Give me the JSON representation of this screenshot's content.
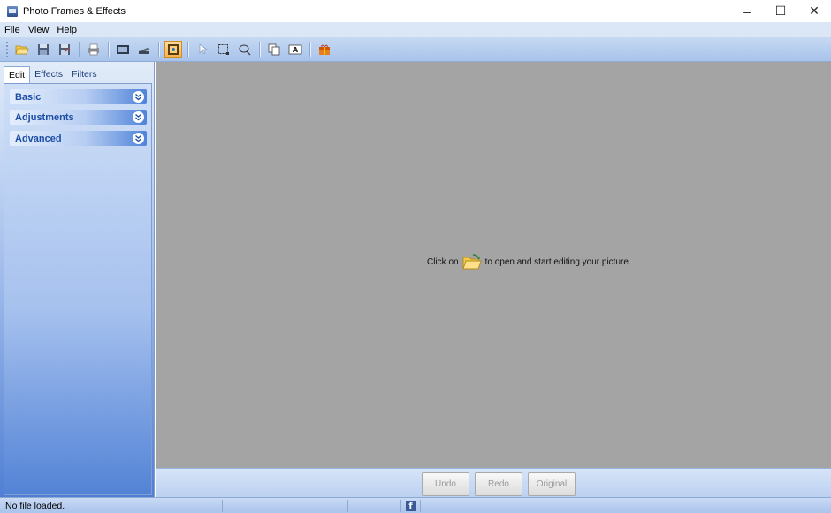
{
  "window": {
    "title": "Photo Frames & Effects",
    "minimize_glyph": "–",
    "maximize_glyph": "☐",
    "close_glyph": "✕"
  },
  "menu": [
    {
      "label": "File"
    },
    {
      "label": "View"
    },
    {
      "label": "Help"
    }
  ],
  "toolbar": {
    "icons": [
      "open-folder-icon",
      "save-icon",
      "save-as-icon",
      "print-icon",
      "screenshot-icon",
      "scanner-icon",
      "frame-icon",
      "pointer-icon",
      "select-rect-icon",
      "select-lasso-icon",
      "copy-icon",
      "text-icon",
      "gift-icon"
    ]
  },
  "sidebar": {
    "tabs": [
      {
        "label": "Edit",
        "active": true
      },
      {
        "label": "Effects",
        "active": false
      },
      {
        "label": "Filters",
        "active": false
      }
    ],
    "sections": [
      {
        "label": "Basic"
      },
      {
        "label": "Adjustments"
      },
      {
        "label": "Advanced"
      }
    ]
  },
  "canvas": {
    "hint_before": "Click on",
    "hint_after": "to open and start editing your picture."
  },
  "actions": {
    "undo": "Undo",
    "redo": "Redo",
    "original": "Original"
  },
  "status": {
    "text": "No file loaded.",
    "facebook_glyph": "f"
  },
  "colors": {
    "accent": "#1b4da6",
    "canvas_bg": "#a4a4a4",
    "toolbar_active": "#f6b04a"
  }
}
